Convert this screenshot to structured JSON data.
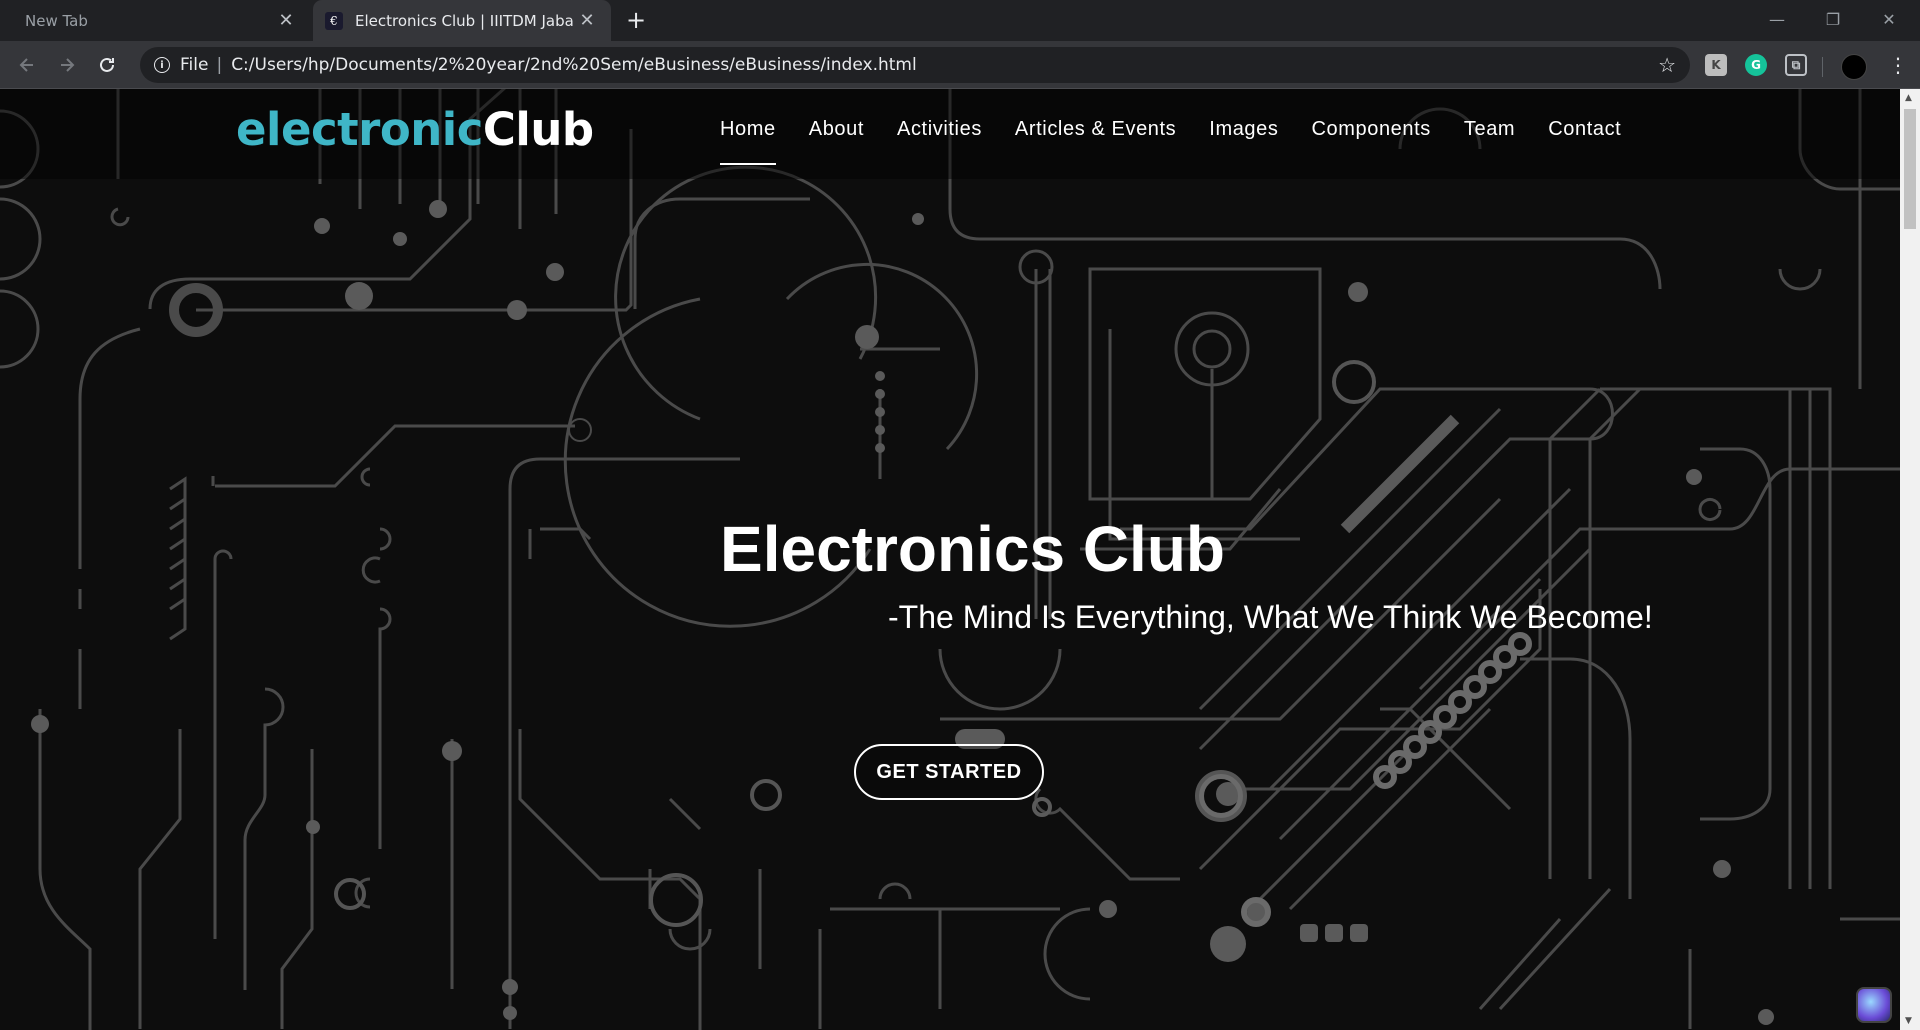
{
  "browser": {
    "tabs": [
      {
        "title": "New Tab",
        "active": false
      },
      {
        "title": "Electronics Club | IIITDM Jabalpur",
        "active": true
      }
    ],
    "new_tab_symbol": "+",
    "close_symbol": "✕",
    "window_controls": {
      "minimize": "—",
      "restore": "❐",
      "close": "✕"
    },
    "nav_icons": {
      "back": "back-arrow-icon",
      "forward": "forward-arrow-icon",
      "reload": "reload-icon"
    },
    "omnibox": {
      "scheme_label": "File",
      "separator": "|",
      "url": "C:/Users/hp/Documents/2%20year/2nd%20Sem/eBusiness/eBusiness/index.html"
    },
    "extensions": [
      {
        "name": "k-extension-icon",
        "glyph": "K"
      },
      {
        "name": "grammarly-icon",
        "glyph": "G"
      },
      {
        "name": "screen-capture-icon",
        "glyph": "⧉"
      }
    ]
  },
  "site": {
    "logo": {
      "part1": "electronic",
      "part2": "Club"
    },
    "nav": [
      {
        "label": "Home",
        "active": true
      },
      {
        "label": "About",
        "active": false
      },
      {
        "label": "Activities",
        "active": false
      },
      {
        "label": "Articles & Events",
        "active": false
      },
      {
        "label": "Images",
        "active": false
      },
      {
        "label": "Components",
        "active": false
      },
      {
        "label": "Team",
        "active": false
      },
      {
        "label": "Contact",
        "active": false
      }
    ],
    "hero": {
      "title": "Electronics Club",
      "subtitle": "-The Mind Is Everything, What We Think We Become!",
      "cta": "GET STARTED"
    }
  },
  "colors": {
    "logo_accent": "#3fb6c7",
    "background": "#0d0d0d",
    "circuit": "#5a5a5a"
  }
}
